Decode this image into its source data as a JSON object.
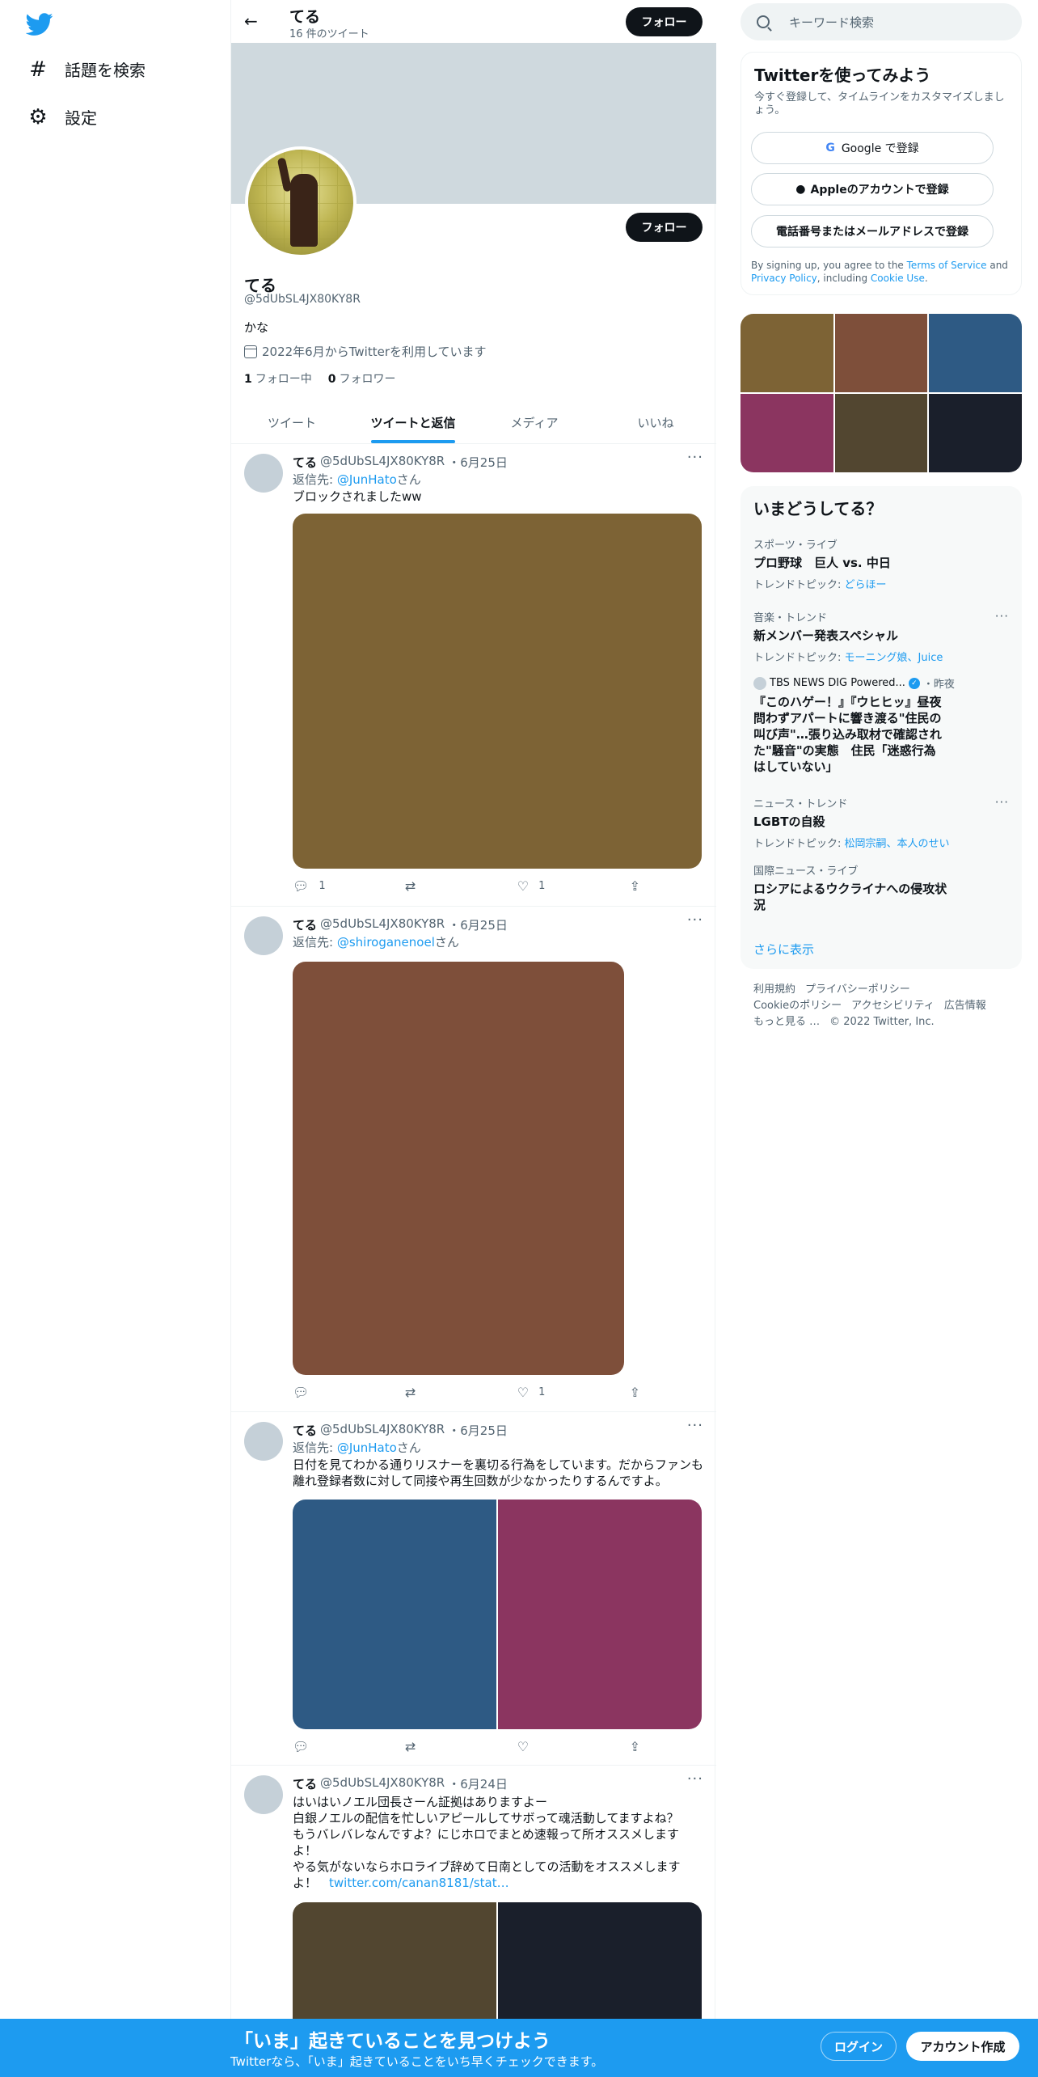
{
  "nav": {
    "explore_label": "話題を検索",
    "settings_label": "設定"
  },
  "header": {
    "name": "てる",
    "tweet_count": "16 件のツイート",
    "follow_label": "フォロー"
  },
  "profile": {
    "name": "てる",
    "handle": "@5dUbSL4JX80KY8R",
    "bio": "かな",
    "joined": "2022年6月からTwitterを利用しています",
    "following_count": "1",
    "following_label": "フォロー中",
    "followers_count": "0",
    "followers_label": "フォロワー",
    "follow_label": "フォロー"
  },
  "tabs": [
    "ツイート",
    "ツイートと返信",
    "メディア",
    "いいね"
  ],
  "tweets": [
    {
      "name": "てる",
      "handle": "@5dUbSL4JX80KY8R",
      "date": "・6月25日",
      "reply_prefix": "返信先: ",
      "reply_to": "@JunHato",
      "reply_suffix": "さん",
      "text": "ブロックされましたww",
      "media_colors": [
        "#7d6335"
      ],
      "reply_count": "1",
      "retweet_count": "",
      "like_count": "1"
    },
    {
      "name": "てる",
      "handle": "@5dUbSL4JX80KY8R",
      "date": "・6月25日",
      "reply_prefix": "返信先: ",
      "reply_to": "@shiroganenoel",
      "reply_suffix": "さん",
      "text": "",
      "media_colors": [
        "#7e4f3a"
      ],
      "reply_count": "",
      "retweet_count": "",
      "like_count": "1"
    },
    {
      "name": "てる",
      "handle": "@5dUbSL4JX80KY8R",
      "date": "・6月25日",
      "reply_prefix": "返信先: ",
      "reply_to": "@JunHato",
      "reply_suffix": "さん",
      "text": "日付を見てわかる通りリスナーを裏切る行為をしています。だからファンも離れ登録者数に対して同接や再生回数が少なかったりするんですよ。",
      "media_colors": [
        "#2e5a84",
        "#8b3560"
      ],
      "reply_count": "",
      "retweet_count": "",
      "like_count": ""
    },
    {
      "name": "てる",
      "handle": "@5dUbSL4JX80KY8R",
      "date": "・6月24日",
      "text_lines": [
        "はいはいノエル団長さーん証拠はありますよー",
        "白銀ノエルの配信を忙しいアピールしてサボって魂活動してますよね？",
        "もうバレバレなんですよ？にじホロでまとめ速報って所オススメします",
        "よ！",
        "やる気がないならホロライブ辞めて日南としての活動をオススメします",
        "よ！"
      ],
      "link": "twitter.com/canan8181/stat…",
      "media_colors": [
        "#524630",
        "#1a1f2b"
      ]
    }
  ],
  "search": {
    "placeholder": "キーワード検索"
  },
  "signup": {
    "title": "Twitterを使ってみよう",
    "subtitle": "今すぐ登録して、タイムラインをカスタマイズしましょう。",
    "google": "Google で登録",
    "apple": "Appleのアカウントで登録",
    "phone": "電話番号またはメールアドレスで登録",
    "legal_pre": "By signing up, you agree to the ",
    "tos": "Terms of Service",
    "legal_and": " and ",
    "privacy": "Privacy Policy",
    "legal_inc": ", including ",
    "cookie": "Cookie Use",
    "legal_end": "."
  },
  "photo_colors": [
    "#7d6335",
    "#7e4f3a",
    "#2e5a84",
    "#8b3560",
    "#524630",
    "#1a1f2b"
  ],
  "trends": {
    "title": "いまどうしてる？",
    "items": [
      {
        "ctx": "スポーツ・ライブ",
        "title": "プロ野球　巨人 vs. 中日",
        "topic_label": "トレンドトピック: ",
        "topic": "どらほー",
        "more": false
      },
      {
        "ctx": "音楽・トレンド",
        "title": "新メンバー発表スペシャル",
        "topic_label": "トレンドトピック: ",
        "topic": "モーニング娘、Juice",
        "more": true
      },
      {
        "ctx": "ニュース・トレンド",
        "title": "LGBTの自殺",
        "topic_label": "トレンドトピック: ",
        "topic": "松岡宗嗣、本人のせい",
        "more": true
      },
      {
        "ctx": "国際ニュース・ライブ",
        "title": "ロシアによるウクライナへの侵攻状況",
        "more": false
      }
    ],
    "news": {
      "source": "TBS NEWS DIG Powered...",
      "time": "・昨夜",
      "title": "『このハゲー！』『ウヒヒッ』昼夜問わずアパートに響き渡る\"住民の叫び声\"…張り込み取材で確認された\"騒音\"の実態　住民「迷惑行為はしていない」"
    },
    "show_more": "さらに表示"
  },
  "footer": {
    "terms": "利用規約",
    "privacy": "プライバシーポリシー",
    "cookie": "Cookieのポリシー",
    "accessibility": "アクセシビリティ",
    "ads": "広告情報",
    "more": "もっと見る …",
    "copyright": "© 2022 Twitter, Inc."
  },
  "bottom_bar": {
    "title": "「いま」起きていることを見つけよう",
    "subtitle": "Twitterなら、「いま」起きていることをいち早くチェックできます。",
    "login": "ログイン",
    "signup": "アカウント作成"
  }
}
